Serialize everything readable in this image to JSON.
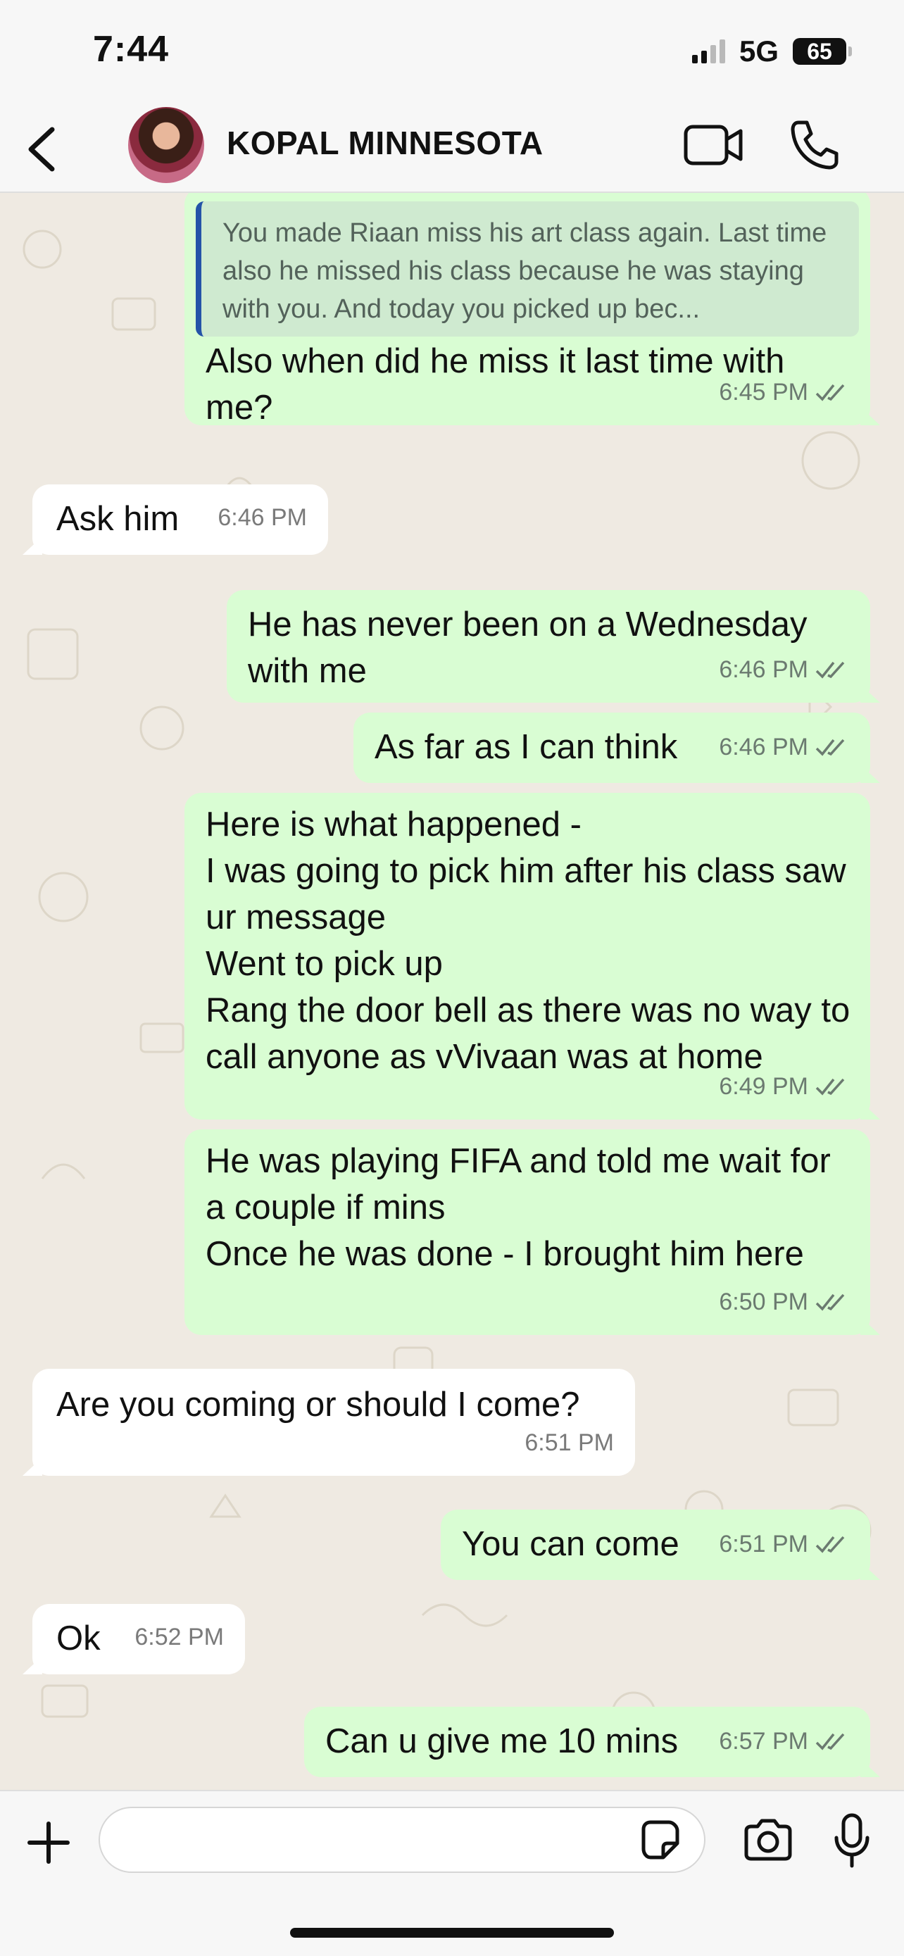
{
  "status_bar": {
    "time": "7:44",
    "network": "5G",
    "battery": "65"
  },
  "header": {
    "contact_name": "KOPAL MINNESOTA",
    "icons": [
      "back-chevron-icon",
      "avatar",
      "video-camera-icon",
      "phone-icon"
    ]
  },
  "messages": [
    {
      "direction": "outgoing",
      "quoted": "You made Riaan miss his art class again. Last time also he missed his class because he was staying with you. And today you picked up bec...",
      "text": "Also when did he miss it last time with me?",
      "time": "6:45 PM",
      "status": "read"
    },
    {
      "direction": "incoming",
      "text": "Ask him",
      "time": "6:46 PM"
    },
    {
      "direction": "outgoing",
      "text": "He has never been on a Wednesday with me",
      "time": "6:46 PM",
      "status": "read"
    },
    {
      "direction": "outgoing",
      "text": "As far as I can think",
      "time": "6:46 PM",
      "status": "read"
    },
    {
      "direction": "outgoing",
      "text": "Here is what happened -\nI was going to pick him after his class saw ur message\nWent to pick up\nRang the door bell as there was no way to call anyone as vVivaan was at home",
      "time": "6:49 PM",
      "status": "read"
    },
    {
      "direction": "outgoing",
      "text": "He was playing FIFA and told me wait for a couple if mins\nOnce he was done - I brought him here",
      "time": "6:50 PM",
      "status": "read"
    },
    {
      "direction": "incoming",
      "text": "Are you coming or should I come?",
      "time": "6:51 PM"
    },
    {
      "direction": "outgoing",
      "text": "You can come",
      "time": "6:51 PM",
      "status": "read"
    },
    {
      "direction": "incoming",
      "text": "Ok",
      "time": "6:52 PM"
    },
    {
      "direction": "outgoing",
      "text": "Can u give me 10 mins",
      "time": "6:57 PM",
      "status": "read"
    }
  ],
  "input_bar": {
    "placeholder": "",
    "value": "",
    "icons": [
      "plus-icon",
      "sticker-icon",
      "camera-icon",
      "microphone-icon"
    ]
  },
  "colors": {
    "outgoing_bubble": "#d9fdd3",
    "incoming_bubble": "#ffffff",
    "chat_background": "#efeae2",
    "quote_bar": "#2453a8",
    "read_ticks": "#6b7a70"
  }
}
